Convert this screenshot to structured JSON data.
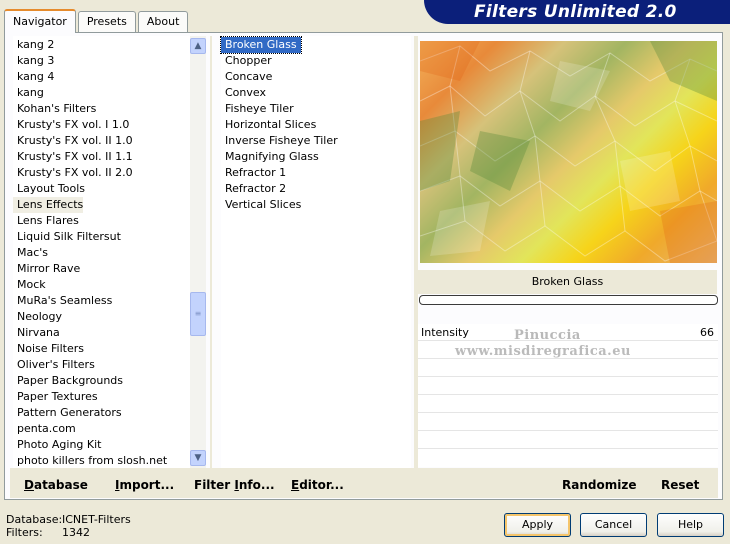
{
  "app": {
    "title": "Filters Unlimited 2.0"
  },
  "tabs": [
    {
      "label": "Navigator",
      "active": true
    },
    {
      "label": "Presets",
      "active": false
    },
    {
      "label": "About",
      "active": false
    }
  ],
  "categories": {
    "items": [
      "kang 2",
      "kang 3",
      "kang 4",
      "kang",
      "Kohan's Filters",
      "Krusty's FX vol. I 1.0",
      "Krusty's FX vol. II 1.0",
      "Krusty's FX vol. II 1.1",
      "Krusty's FX vol. II 2.0",
      "Layout Tools",
      "Lens Effects",
      "Lens Flares",
      "Liquid Silk Filtersut",
      "Mac's",
      "Mirror Rave",
      "Mock",
      "MuRa's Seamless",
      "Neology",
      "Nirvana",
      "Noise Filters",
      "Oliver's Filters",
      "Paper Backgrounds",
      "Paper Textures",
      "Pattern Generators",
      "penta.com",
      "Photo Aging Kit",
      "photo killers from slosh.net"
    ],
    "selected": "Lens Effects"
  },
  "filters": {
    "items": [
      "Broken Glass",
      "Chopper",
      "Concave",
      "Convex",
      "Fisheye Tiler",
      "Horizontal Slices",
      "Inverse Fisheye Tiler",
      "Magnifying Glass",
      "Refractor 1",
      "Refractor 2",
      "Vertical Slices"
    ],
    "selected": "Broken Glass"
  },
  "preview": {
    "filter_name": "Broken Glass"
  },
  "parameters": [
    {
      "label": "Intensity",
      "value": "66"
    }
  ],
  "watermark": {
    "line1": "Pinuccia",
    "line2": "www.misdiregrafica.eu"
  },
  "toolbar": {
    "database": {
      "first": "D",
      "rest": "atabase"
    },
    "import": {
      "first": "I",
      "rest": "mport..."
    },
    "filter_info": {
      "pre": "Filter ",
      "first": "I",
      "rest": "nfo..."
    },
    "editor": {
      "first": "E",
      "rest": "ditor..."
    },
    "randomize": "Randomize",
    "reset": "Reset"
  },
  "status": {
    "database_label": "Database:",
    "database_value": "ICNET-Filters",
    "filters_label": "Filters:",
    "filters_value": "1342"
  },
  "dialog": {
    "apply": "Apply",
    "cancel": "Cancel",
    "help": "Help"
  },
  "icons": {
    "scroll_up": "chevron-up-icon",
    "scroll_down": "chevron-down-icon",
    "scroll_grip": "grip-icon"
  },
  "colors": {
    "banner": "#0b1f7a",
    "selection": "#316ac5",
    "accent_tab": "#e68b2c"
  }
}
